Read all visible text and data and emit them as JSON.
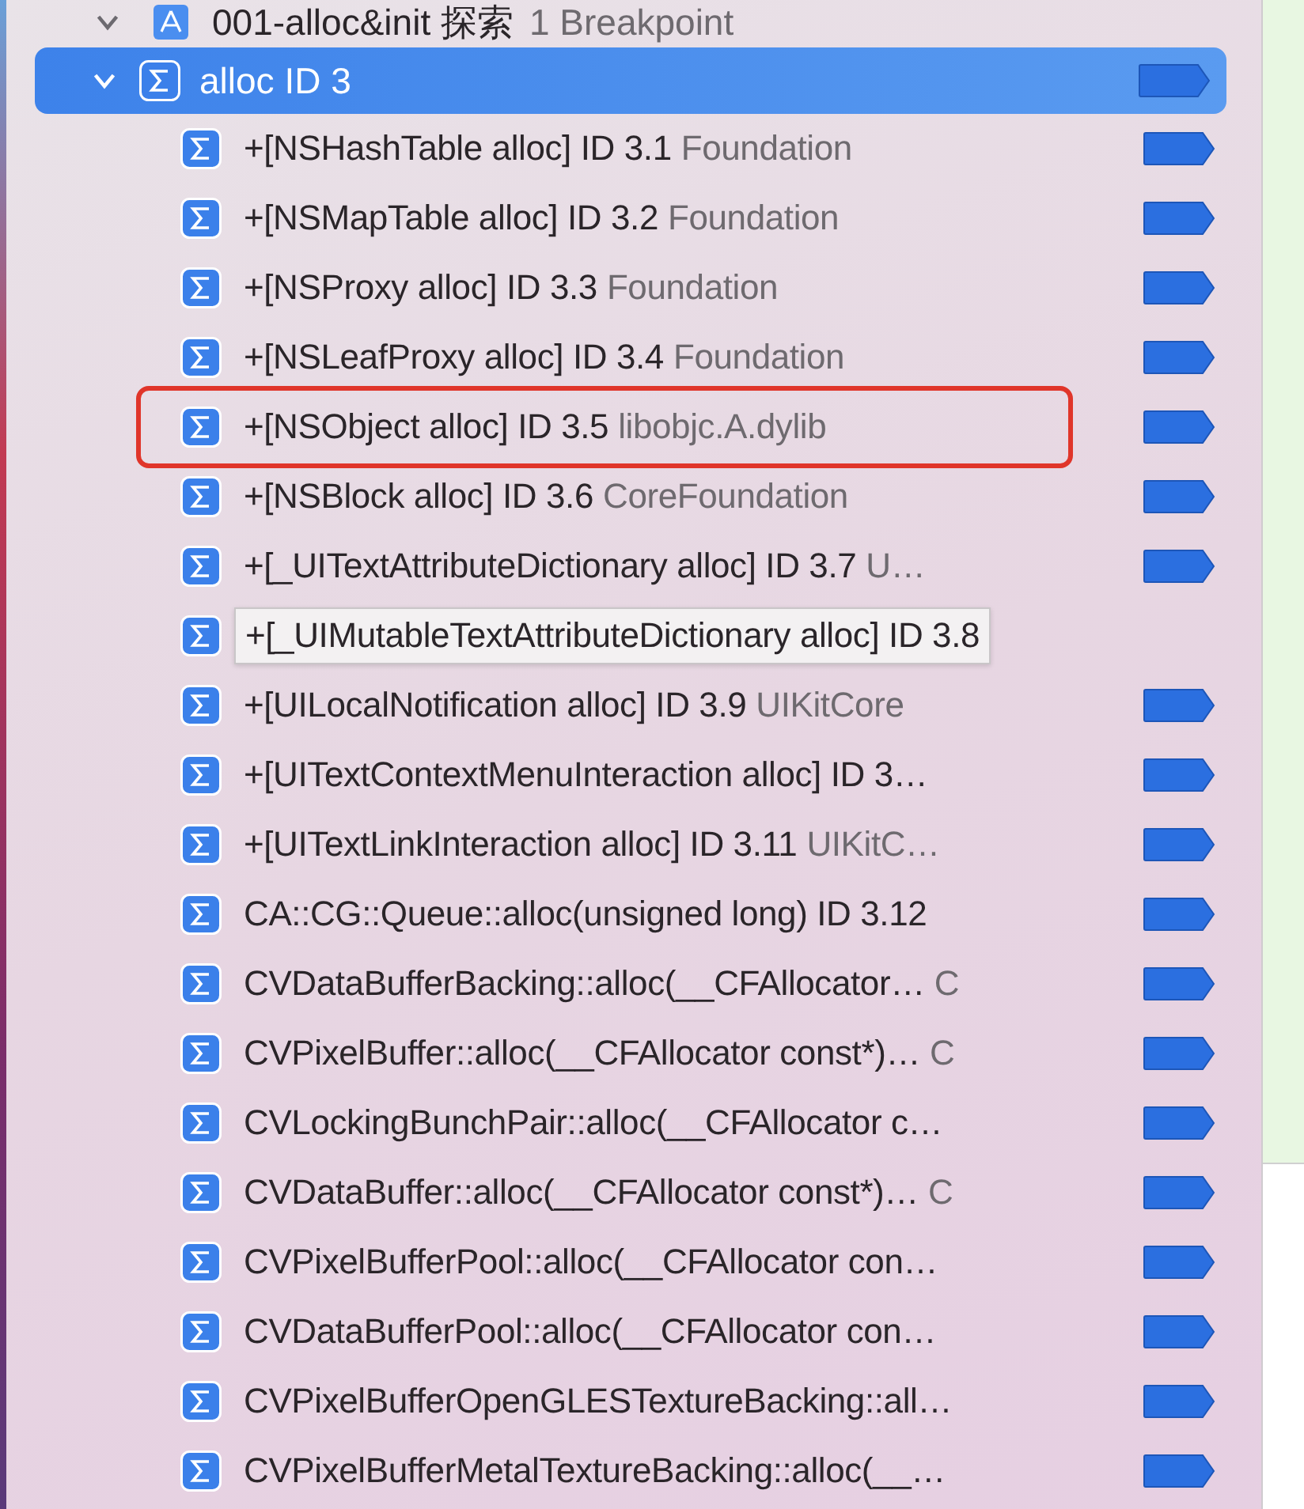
{
  "group": {
    "title": "001-alloc&init 探索",
    "subtitle": "1 Breakpoint",
    "expanded": true
  },
  "breakpoint": {
    "label": "alloc ID 3",
    "selected": true,
    "expanded": true,
    "children": [
      {
        "main": "+[NSHashTable alloc]  ID 3.1",
        "detail": "Foundation",
        "selected": false,
        "highlighted": false,
        "tooltip": false
      },
      {
        "main": "+[NSMapTable alloc]  ID 3.2",
        "detail": "Foundation",
        "selected": false,
        "highlighted": false,
        "tooltip": false
      },
      {
        "main": "+[NSProxy alloc]  ID 3.3",
        "detail": "Foundation",
        "selected": false,
        "highlighted": false,
        "tooltip": false
      },
      {
        "main": "+[NSLeafProxy alloc]  ID 3.4",
        "detail": "Foundation",
        "selected": false,
        "highlighted": false,
        "tooltip": false
      },
      {
        "main": "+[NSObject alloc]  ID 3.5",
        "detail": "libobjc.A.dylib",
        "selected": false,
        "highlighted": true,
        "tooltip": false
      },
      {
        "main": "+[NSBlock alloc]  ID 3.6",
        "detail": "CoreFoundation",
        "selected": false,
        "highlighted": false,
        "tooltip": false
      },
      {
        "main": "+[_UITextAttributeDictionary alloc]  ID 3.7",
        "detail": "U…",
        "selected": false,
        "highlighted": false,
        "tooltip": false
      },
      {
        "main": "+[_UIMutableTextAttributeDictionary alloc]  ID 3.8",
        "selected": false,
        "highlighted": false,
        "tooltip": true
      },
      {
        "main": "+[UILocalNotification alloc]  ID 3.9",
        "detail": "UIKitCore",
        "selected": false,
        "highlighted": false,
        "tooltip": false
      },
      {
        "main": "+[UITextContextMenuInteraction alloc]  ID 3…",
        "selected": false,
        "highlighted": false,
        "tooltip": false
      },
      {
        "main": "+[UITextLinkInteraction alloc]  ID 3.11",
        "detail": "UIKitC…",
        "selected": false,
        "highlighted": false,
        "tooltip": false
      },
      {
        "main": "CA::CG::Queue::alloc(unsigned long)  ID 3.12",
        "selected": false,
        "highlighted": false,
        "tooltip": false
      },
      {
        "main": "CVDataBufferBacking::alloc(__CFAllocator…",
        "detail": "C",
        "selected": false,
        "highlighted": false,
        "tooltip": false
      },
      {
        "main": "CVPixelBuffer::alloc(__CFAllocator const*)…",
        "detail": "C",
        "selected": false,
        "highlighted": false,
        "tooltip": false
      },
      {
        "main": "CVLockingBunchPair::alloc(__CFAllocator c…",
        "selected": false,
        "highlighted": false,
        "tooltip": false
      },
      {
        "main": "CVDataBuffer::alloc(__CFAllocator const*)…",
        "detail": "C",
        "selected": false,
        "highlighted": false,
        "tooltip": false
      },
      {
        "main": "CVPixelBufferPool::alloc(__CFAllocator con…",
        "selected": false,
        "highlighted": false,
        "tooltip": false
      },
      {
        "main": "CVDataBufferPool::alloc(__CFAllocator con…",
        "selected": false,
        "highlighted": false,
        "tooltip": false
      },
      {
        "main": "CVPixelBufferOpenGLESTextureBacking::all…",
        "selected": false,
        "highlighted": false,
        "tooltip": false
      },
      {
        "main": "CVPixelBufferMetalTextureBacking::alloc(__…",
        "selected": false,
        "highlighted": false,
        "tooltip": false
      }
    ]
  }
}
